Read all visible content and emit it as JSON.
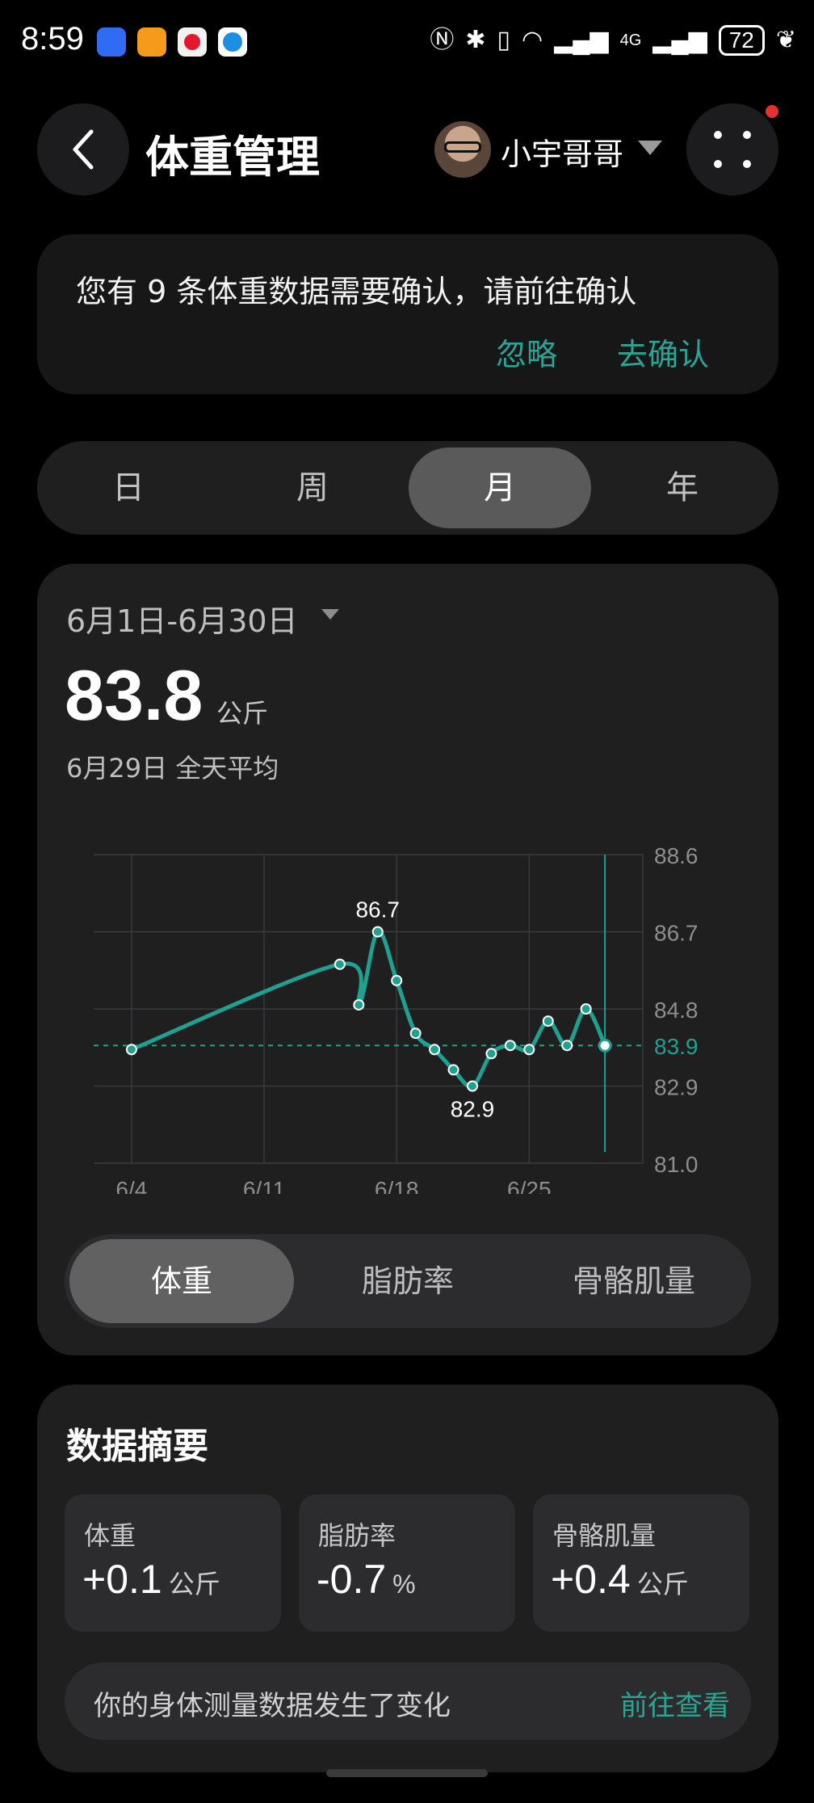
{
  "status": {
    "time": "8:59",
    "network": "4G",
    "battery": "72"
  },
  "header": {
    "title": "体重管理",
    "user_name": "小宇哥哥"
  },
  "banner": {
    "message": "您有 9 条体重数据需要确认，请前往确认",
    "ignore_label": "忽略",
    "confirm_label": "去确认"
  },
  "period_tabs": [
    {
      "label": "日"
    },
    {
      "label": "周"
    },
    {
      "label": "月",
      "active": true
    },
    {
      "label": "年"
    }
  ],
  "summary_chart": {
    "range": "6月1日-6月30日",
    "value": "83.8",
    "unit": "公斤",
    "subtitle": "6月29日 全天平均"
  },
  "chart_data": {
    "type": "line",
    "ylim": [
      81.0,
      88.6
    ],
    "y_ticks": [
      "88.6",
      "86.7",
      "84.8",
      "83.9",
      "82.9",
      "81.0"
    ],
    "x_ticks": [
      "6/4",
      "6/11",
      "6/18",
      "6/25"
    ],
    "reference_line": 83.9,
    "annotations": [
      {
        "label": "86.7",
        "x": 17,
        "y": 86.7
      },
      {
        "label": "82.9",
        "x": 22,
        "y": 82.9
      }
    ],
    "series": [
      {
        "points": [
          {
            "x": 4,
            "y": 83.8
          },
          {
            "x": 15,
            "y": 85.9
          },
          {
            "x": 16,
            "y": 84.9
          },
          {
            "x": 17,
            "y": 86.7
          },
          {
            "x": 18,
            "y": 85.5
          },
          {
            "x": 19,
            "y": 84.2
          },
          {
            "x": 20,
            "y": 83.8
          },
          {
            "x": 21,
            "y": 83.3
          },
          {
            "x": 22,
            "y": 82.9
          },
          {
            "x": 23,
            "y": 83.7
          },
          {
            "x": 24,
            "y": 83.9
          },
          {
            "x": 25,
            "y": 83.8
          },
          {
            "x": 26,
            "y": 84.5
          },
          {
            "x": 27,
            "y": 83.9
          },
          {
            "x": 28,
            "y": 84.8
          },
          {
            "x": 29,
            "y": 83.9
          }
        ]
      }
    ],
    "colors": {
      "line": "#1fa090",
      "grid": "#3a3a3c"
    }
  },
  "metric_tabs": [
    {
      "label": "体重",
      "active": true
    },
    {
      "label": "脂肪率"
    },
    {
      "label": "骨骼肌量"
    }
  ],
  "summary": {
    "title": "数据摘要",
    "stats": [
      {
        "label": "体重",
        "value": "+0.1",
        "unit": "公斤"
      },
      {
        "label": "脂肪率",
        "value": "-0.7",
        "unit": "%"
      },
      {
        "label": "骨骼肌量",
        "value": "+0.4",
        "unit": "公斤"
      }
    ],
    "change_text": "你的身体测量数据发生了变化",
    "change_link": "前往查看"
  },
  "accent_color": "#2aa595"
}
